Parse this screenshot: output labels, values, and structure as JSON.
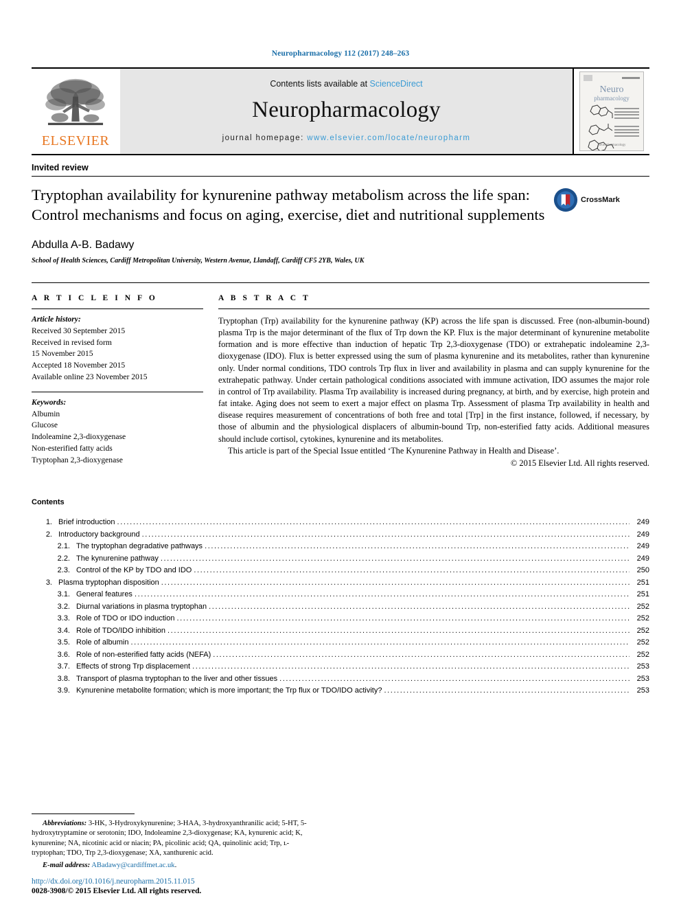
{
  "running_head": "Neuropharmacology 112 (2017) 248–263",
  "masthead": {
    "publisher_logo_label": "ELSEVIER",
    "contents_prefix": "Contents lists available at ",
    "sciencedirect": "ScienceDirect",
    "journal_name": "Neuropharmacology",
    "homepage_prefix": "journal homepage: ",
    "homepage_url": "www.elsevier.com/locate/neuropharm",
    "cover": {
      "title_line1": "Neuro",
      "title_line2": "pharmacology",
      "footer": "Neuropharmacology"
    }
  },
  "article": {
    "type": "Invited review",
    "title": "Tryptophan availability for kynurenine pathway metabolism across the life span: Control mechanisms and focus on aging, exercise, diet and nutritional supplements",
    "crossmark_label": "CrossMark",
    "author": "Abdulla A-B. Badawy",
    "affiliation": "School of Health Sciences, Cardiff Metropolitan University, Western Avenue, Llandaff, Cardiff CF5 2YB, Wales, UK"
  },
  "article_info": {
    "heading": "A R T I C L E   I N F O",
    "history_label": "Article history:",
    "history": [
      "Received 30 September 2015",
      "Received in revised form",
      "15 November 2015",
      "Accepted 18 November 2015",
      "Available online 23 November 2015"
    ],
    "keywords_label": "Keywords:",
    "keywords": [
      "Albumin",
      "Glucose",
      "Indoleamine 2,3-dioxygenase",
      "Non-esterified fatty acids",
      "Tryptophan 2,3-dioxygenase"
    ]
  },
  "abstract": {
    "heading": "A B S T R A C T",
    "body": "Tryptophan (Trp) availability for the kynurenine pathway (KP) across the life span is discussed. Free (non-albumin-bound) plasma Trp is the major determinant of the flux of Trp down the KP. Flux is the major determinant of kynurenine metabolite formation and is more effective than induction of hepatic Trp 2,3-dioxygenase (TDO) or extrahepatic indoleamine 2,3-dioxygenase (IDO). Flux is better expressed using the sum of plasma kynurenine and its metabolites, rather than kynurenine only. Under normal conditions, TDO controls Trp flux in liver and availability in plasma and can supply kynurenine for the extrahepatic pathway. Under certain pathological conditions associated with immune activation, IDO assumes the major role in control of Trp availability. Plasma Trp availability is increased during pregnancy, at birth, and by exercise, high protein and fat intake. Aging does not seem to exert a major effect on plasma Trp. Assessment of plasma Trp availability in health and disease requires measurement of concentrations of both free and total [Trp] in the first instance, followed, if necessary, by those of albumin and the physiological displacers of albumin-bound Trp, non-esterified fatty acids. Additional measures should include cortisol, cytokines, kynurenine and its metabolites.",
    "special_issue": "This article is part of the Special Issue entitled ‘The Kynurenine Pathway in Health and Disease’.",
    "copyright": "© 2015 Elsevier Ltd. All rights reserved."
  },
  "contents": {
    "title": "Contents",
    "items": [
      {
        "num": "1.",
        "level": 1,
        "label": "Brief introduction",
        "page": "249"
      },
      {
        "num": "2.",
        "level": 1,
        "label": "Introductory background",
        "page": "249"
      },
      {
        "num": "2.1.",
        "level": 2,
        "label": "The tryptophan degradative pathways",
        "page": "249"
      },
      {
        "num": "2.2.",
        "level": 2,
        "label": "The kynurenine pathway",
        "page": "249"
      },
      {
        "num": "2.3.",
        "level": 2,
        "label": "Control of the KP by TDO and IDO",
        "page": "250"
      },
      {
        "num": "3.",
        "level": 1,
        "label": "Plasma tryptophan disposition",
        "page": "251"
      },
      {
        "num": "3.1.",
        "level": 2,
        "label": "General features",
        "page": "251"
      },
      {
        "num": "3.2.",
        "level": 2,
        "label": "Diurnal variations in plasma tryptophan",
        "page": "252"
      },
      {
        "num": "3.3.",
        "level": 2,
        "label": "Role of TDO or IDO induction",
        "page": "252"
      },
      {
        "num": "3.4.",
        "level": 2,
        "label": "Role of TDO/IDO inhibition",
        "page": "252"
      },
      {
        "num": "3.5.",
        "level": 2,
        "label": "Role of albumin",
        "page": "252"
      },
      {
        "num": "3.6.",
        "level": 2,
        "label": "Role of non-esterified fatty acids (NEFA)",
        "page": "252"
      },
      {
        "num": "3.7.",
        "level": 2,
        "label": "Effects of strong Trp displacement",
        "page": "253"
      },
      {
        "num": "3.8.",
        "level": 2,
        "label": "Transport of plasma tryptophan to the liver and other tissues",
        "page": "253"
      },
      {
        "num": "3.9.",
        "level": 2,
        "label": "Kynurenine metabolite formation; which is more important; the Trp flux or TDO/IDO activity?",
        "page": "253"
      }
    ]
  },
  "footnotes": {
    "abbreviations_label": "Abbreviations:",
    "abbreviations_text": "3-HK, 3-Hydroxykynurenine; 3-HAA, 3-hydroxyanthranilic acid; 5-HT, 5-hydroxytryptamine or serotonin; IDO, Indoleamine 2,3-dioxygenase; KA, kynurenic acid; K, kynurenine; NA, nicotinic acid or niacin; PA, picolinic acid; QA, quinolinic acid; Trp, ʟ-tryptophan; TDO, Trp 2,3-dioxygenase; XA, xanthurenic acid.",
    "email_label": "E-mail address:",
    "email": "ABadawy@cardiffmet.ac.uk",
    "doi": "http://dx.doi.org/10.1016/j.neuropharm.2015.11.015",
    "issn_copyright": "0028-3908/© 2015 Elsevier Ltd. All rights reserved."
  },
  "colors": {
    "link_blue": "#1a6ea8",
    "sciencedirect_blue": "#3a9bd4",
    "elsevier_orange": "#e87722"
  }
}
